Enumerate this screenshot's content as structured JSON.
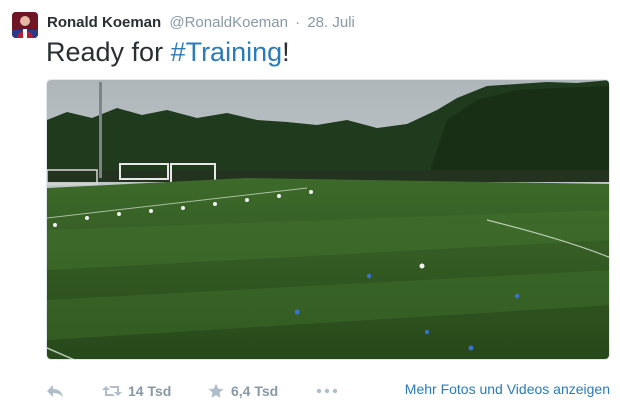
{
  "tweet": {
    "author": {
      "name": "Ronald Koeman",
      "handle": "@RonaldKoeman"
    },
    "separator": "·",
    "timestamp": "28. Juli",
    "text": {
      "before": "Ready for ",
      "hashtag": "#Training",
      "after": "!"
    },
    "actions": {
      "retweet_count": "14 Tsd",
      "favorite_count": "6,4 Tsd",
      "more_media_link": "Mehr Fotos und Videos anzeigen"
    },
    "icons": {
      "avatar": "profile-photo",
      "reply": "reply-arrow-icon",
      "retweet": "retweet-icon",
      "favorite": "star-icon",
      "more": "ellipsis-icon"
    },
    "colors": {
      "link": "#2b7bb9",
      "muted": "#8899a6",
      "text": "#292f33"
    }
  }
}
